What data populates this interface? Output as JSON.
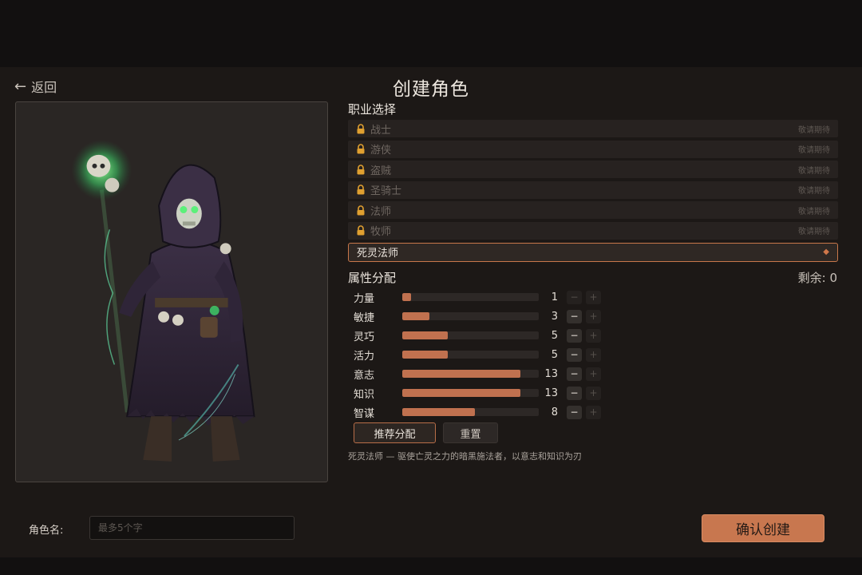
{
  "header": {
    "back_label": "返回",
    "title": "创建角色"
  },
  "class_selection": {
    "title": "职业选择",
    "locked_hint": "敬请期待",
    "classes": [
      {
        "name": "战士",
        "locked": true
      },
      {
        "name": "游侠",
        "locked": true
      },
      {
        "name": "盗贼",
        "locked": true
      },
      {
        "name": "圣骑士",
        "locked": true
      },
      {
        "name": "法师",
        "locked": true
      },
      {
        "name": "牧师",
        "locked": true
      },
      {
        "name": "死灵法师",
        "locked": false,
        "selected": true
      }
    ],
    "selected_marker": "◆"
  },
  "attributes": {
    "title": "属性分配",
    "remaining_label": "剩余: 0",
    "max_value": 15,
    "minus_symbol": "−",
    "plus_symbol": "+",
    "stats": [
      {
        "label": "力量",
        "value": 1,
        "minus_enabled": false,
        "plus_enabled": false
      },
      {
        "label": "敏捷",
        "value": 3,
        "minus_enabled": true,
        "plus_enabled": false
      },
      {
        "label": "灵巧",
        "value": 5,
        "minus_enabled": true,
        "plus_enabled": false
      },
      {
        "label": "活力",
        "value": 5,
        "minus_enabled": true,
        "plus_enabled": false
      },
      {
        "label": "意志",
        "value": 13,
        "minus_enabled": true,
        "plus_enabled": false
      },
      {
        "label": "知识",
        "value": 13,
        "minus_enabled": true,
        "plus_enabled": false
      },
      {
        "label": "智谋",
        "value": 8,
        "minus_enabled": true,
        "plus_enabled": false
      }
    ],
    "recommend_label": "推荐分配",
    "reset_label": "重置",
    "description": "死灵法师 — 驱使亡灵之力的暗黑施法者，以意志和知识为刃"
  },
  "footer": {
    "name_label": "角色名:",
    "name_placeholder": "最多5个字",
    "name_value": "",
    "confirm_label": "确认创建"
  },
  "colors": {
    "accent": "#c8774f",
    "bar_fill": "#c0714f",
    "lock": "#e0a030",
    "necro_glow": "#5cf07a"
  }
}
